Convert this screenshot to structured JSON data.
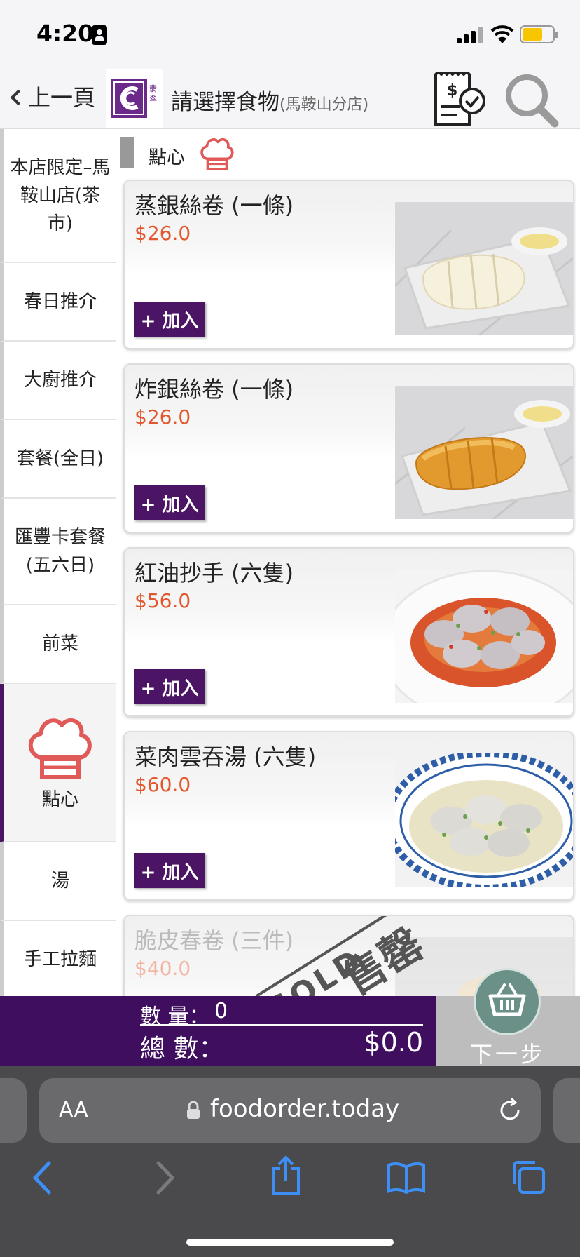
{
  "status_bar": {
    "time": "4:20"
  },
  "header": {
    "back_label": "上一頁",
    "title": "請選擇食物",
    "branch": "(馬鞍山分店)",
    "logo_text": "翡翠"
  },
  "sidebar": {
    "items": [
      {
        "label": "本店限定–馬鞍山店(茶市)"
      },
      {
        "label": "春日推介"
      },
      {
        "label": "大廚推介"
      },
      {
        "label": "套餐(全日)"
      },
      {
        "label": "匯豐卡套餐(五六日)"
      },
      {
        "label": "前菜"
      },
      {
        "label": "點心",
        "active": true
      },
      {
        "label": "湯"
      },
      {
        "label": "手工拉麵"
      }
    ]
  },
  "section": {
    "title": "點心"
  },
  "menu_items": [
    {
      "name": "蒸銀絲卷 (一條)",
      "price": "$26.0",
      "add_label": "+ 加入"
    },
    {
      "name": "炸銀絲卷 (一條)",
      "price": "$26.0",
      "add_label": "+ 加入"
    },
    {
      "name": "紅油抄手 (六隻)",
      "price": "$56.0",
      "add_label": "+ 加入"
    },
    {
      "name": "菜肉雲吞湯 (六隻)",
      "price": "$60.0",
      "add_label": "+ 加入"
    },
    {
      "name": "脆皮春卷 (三件)",
      "price": "$40.0",
      "sold_out": true,
      "sold_label": "SOLD",
      "sold_label_cn": "售罄"
    }
  ],
  "cart": {
    "quantity_label": "數 量：",
    "quantity": "0",
    "total_label": "總 數：",
    "total": "$0.0",
    "next_label": "下一步"
  },
  "browser": {
    "text_size_label": "AA",
    "url": "foodorder.today"
  },
  "colors": {
    "brand": "#4b1464",
    "price": "#e2582e",
    "chef_icon": "#e05a5a"
  }
}
